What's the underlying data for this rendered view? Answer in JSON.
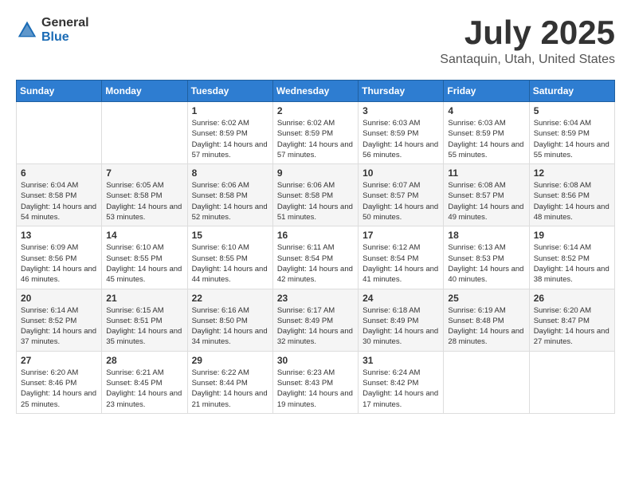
{
  "header": {
    "logo": {
      "general": "General",
      "blue": "Blue"
    },
    "title": "July 2025",
    "location": "Santaquin, Utah, United States"
  },
  "weekdays": [
    "Sunday",
    "Monday",
    "Tuesday",
    "Wednesday",
    "Thursday",
    "Friday",
    "Saturday"
  ],
  "weeks": [
    [
      null,
      null,
      {
        "day": "1",
        "sunrise": "6:02 AM",
        "sunset": "8:59 PM",
        "daylight": "14 hours and 57 minutes."
      },
      {
        "day": "2",
        "sunrise": "6:02 AM",
        "sunset": "8:59 PM",
        "daylight": "14 hours and 57 minutes."
      },
      {
        "day": "3",
        "sunrise": "6:03 AM",
        "sunset": "8:59 PM",
        "daylight": "14 hours and 56 minutes."
      },
      {
        "day": "4",
        "sunrise": "6:03 AM",
        "sunset": "8:59 PM",
        "daylight": "14 hours and 55 minutes."
      },
      {
        "day": "5",
        "sunrise": "6:04 AM",
        "sunset": "8:59 PM",
        "daylight": "14 hours and 55 minutes."
      }
    ],
    [
      {
        "day": "6",
        "sunrise": "6:04 AM",
        "sunset": "8:58 PM",
        "daylight": "14 hours and 54 minutes."
      },
      {
        "day": "7",
        "sunrise": "6:05 AM",
        "sunset": "8:58 PM",
        "daylight": "14 hours and 53 minutes."
      },
      {
        "day": "8",
        "sunrise": "6:06 AM",
        "sunset": "8:58 PM",
        "daylight": "14 hours and 52 minutes."
      },
      {
        "day": "9",
        "sunrise": "6:06 AM",
        "sunset": "8:58 PM",
        "daylight": "14 hours and 51 minutes."
      },
      {
        "day": "10",
        "sunrise": "6:07 AM",
        "sunset": "8:57 PM",
        "daylight": "14 hours and 50 minutes."
      },
      {
        "day": "11",
        "sunrise": "6:08 AM",
        "sunset": "8:57 PM",
        "daylight": "14 hours and 49 minutes."
      },
      {
        "day": "12",
        "sunrise": "6:08 AM",
        "sunset": "8:56 PM",
        "daylight": "14 hours and 48 minutes."
      }
    ],
    [
      {
        "day": "13",
        "sunrise": "6:09 AM",
        "sunset": "8:56 PM",
        "daylight": "14 hours and 46 minutes."
      },
      {
        "day": "14",
        "sunrise": "6:10 AM",
        "sunset": "8:55 PM",
        "daylight": "14 hours and 45 minutes."
      },
      {
        "day": "15",
        "sunrise": "6:10 AM",
        "sunset": "8:55 PM",
        "daylight": "14 hours and 44 minutes."
      },
      {
        "day": "16",
        "sunrise": "6:11 AM",
        "sunset": "8:54 PM",
        "daylight": "14 hours and 42 minutes."
      },
      {
        "day": "17",
        "sunrise": "6:12 AM",
        "sunset": "8:54 PM",
        "daylight": "14 hours and 41 minutes."
      },
      {
        "day": "18",
        "sunrise": "6:13 AM",
        "sunset": "8:53 PM",
        "daylight": "14 hours and 40 minutes."
      },
      {
        "day": "19",
        "sunrise": "6:14 AM",
        "sunset": "8:52 PM",
        "daylight": "14 hours and 38 minutes."
      }
    ],
    [
      {
        "day": "20",
        "sunrise": "6:14 AM",
        "sunset": "8:52 PM",
        "daylight": "14 hours and 37 minutes."
      },
      {
        "day": "21",
        "sunrise": "6:15 AM",
        "sunset": "8:51 PM",
        "daylight": "14 hours and 35 minutes."
      },
      {
        "day": "22",
        "sunrise": "6:16 AM",
        "sunset": "8:50 PM",
        "daylight": "14 hours and 34 minutes."
      },
      {
        "day": "23",
        "sunrise": "6:17 AM",
        "sunset": "8:49 PM",
        "daylight": "14 hours and 32 minutes."
      },
      {
        "day": "24",
        "sunrise": "6:18 AM",
        "sunset": "8:49 PM",
        "daylight": "14 hours and 30 minutes."
      },
      {
        "day": "25",
        "sunrise": "6:19 AM",
        "sunset": "8:48 PM",
        "daylight": "14 hours and 28 minutes."
      },
      {
        "day": "26",
        "sunrise": "6:20 AM",
        "sunset": "8:47 PM",
        "daylight": "14 hours and 27 minutes."
      }
    ],
    [
      {
        "day": "27",
        "sunrise": "6:20 AM",
        "sunset": "8:46 PM",
        "daylight": "14 hours and 25 minutes."
      },
      {
        "day": "28",
        "sunrise": "6:21 AM",
        "sunset": "8:45 PM",
        "daylight": "14 hours and 23 minutes."
      },
      {
        "day": "29",
        "sunrise": "6:22 AM",
        "sunset": "8:44 PM",
        "daylight": "14 hours and 21 minutes."
      },
      {
        "day": "30",
        "sunrise": "6:23 AM",
        "sunset": "8:43 PM",
        "daylight": "14 hours and 19 minutes."
      },
      {
        "day": "31",
        "sunrise": "6:24 AM",
        "sunset": "8:42 PM",
        "daylight": "14 hours and 17 minutes."
      },
      null,
      null
    ]
  ]
}
